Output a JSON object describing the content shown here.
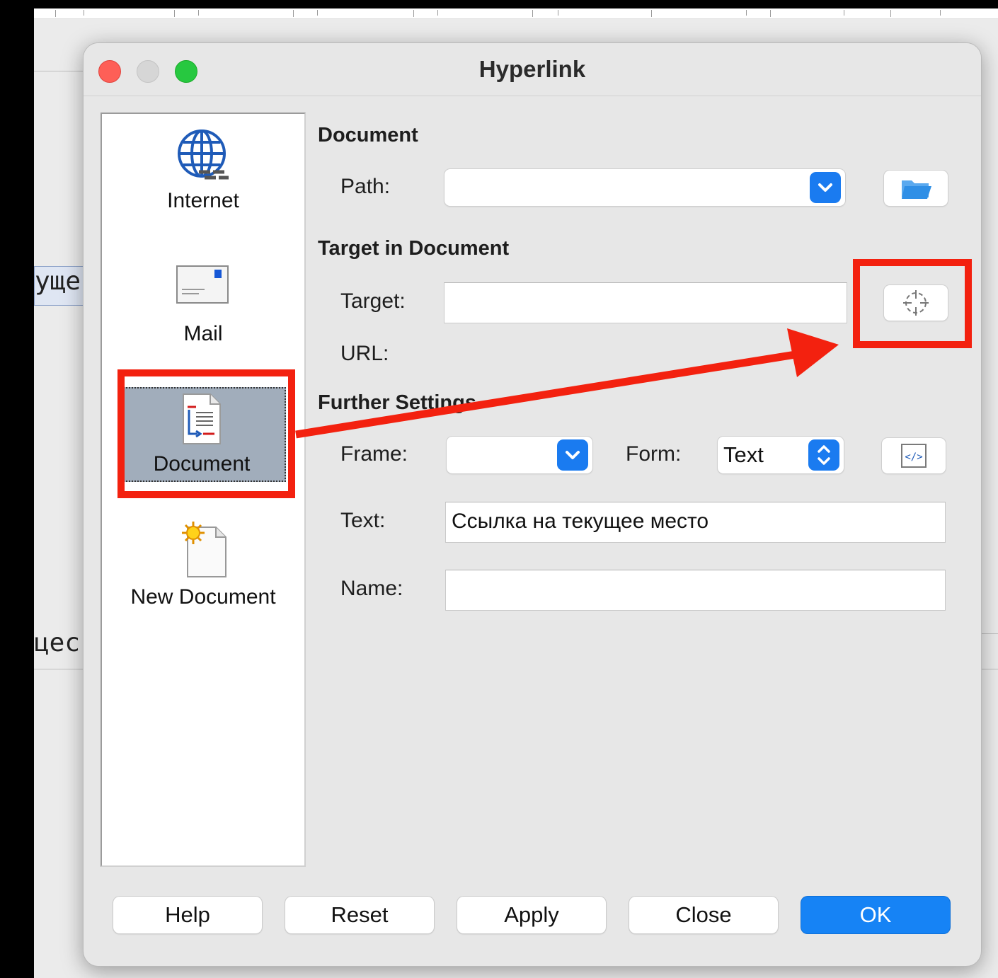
{
  "background": {
    "text_fragment_1": "уще",
    "text_fragment_2": "цес"
  },
  "dialog": {
    "title": "Hyperlink"
  },
  "sidebar": {
    "items": [
      {
        "label": "Internet",
        "icon": "globe-icon"
      },
      {
        "label": "Mail",
        "icon": "envelope-icon"
      },
      {
        "label": "Document",
        "icon": "document-icon",
        "selected": true
      },
      {
        "label": "New Document",
        "icon": "new-document-icon"
      }
    ]
  },
  "document_section": {
    "title": "Document",
    "path_label": "Path:",
    "path_value": ""
  },
  "target_section": {
    "title": "Target in Document",
    "target_label": "Target:",
    "target_value": "",
    "url_label": "URL:"
  },
  "further_settings": {
    "title": "Further Settings",
    "frame_label": "Frame:",
    "frame_value": "",
    "form_label": "Form:",
    "form_value": "Text",
    "text_label": "Text:",
    "text_value": "Ссылка на текущее место",
    "name_label": "Name:",
    "name_value": ""
  },
  "buttons": {
    "help": "Help",
    "reset": "Reset",
    "apply": "Apply",
    "close": "Close",
    "ok": "OK"
  },
  "colors": {
    "accent": "#1683f5",
    "annotation": "#f3210f"
  }
}
